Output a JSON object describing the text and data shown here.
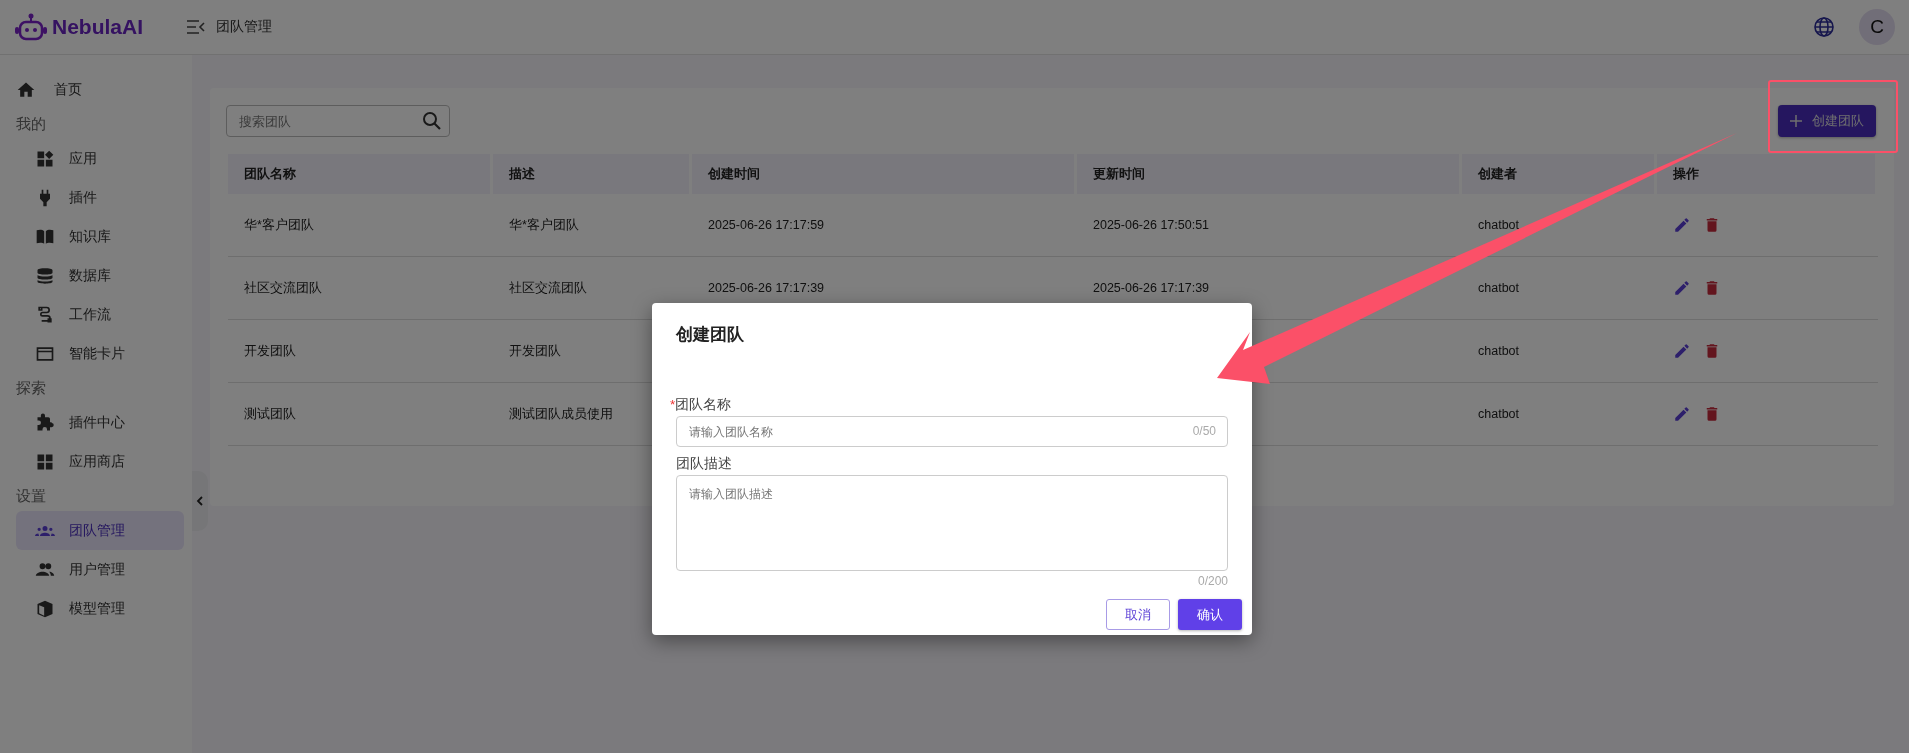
{
  "header": {
    "logo": "NebulaAI",
    "title": "团队管理",
    "avatar": "C"
  },
  "sidebar": [
    {
      "kind": "item",
      "label": "首页",
      "selected": false
    },
    {
      "kind": "section",
      "label": "我的"
    },
    {
      "kind": "item",
      "label": "应用",
      "selected": false
    },
    {
      "kind": "item",
      "label": "插件",
      "selected": false
    },
    {
      "kind": "item",
      "label": "知识库",
      "selected": false
    },
    {
      "kind": "item",
      "label": "数据库",
      "selected": false
    },
    {
      "kind": "item",
      "label": "工作流",
      "selected": false
    },
    {
      "kind": "item",
      "label": "智能卡片",
      "selected": false
    },
    {
      "kind": "section",
      "label": "探索"
    },
    {
      "kind": "item",
      "label": "插件中心",
      "selected": false
    },
    {
      "kind": "item",
      "label": "应用商店",
      "selected": false
    },
    {
      "kind": "section",
      "label": "设置"
    },
    {
      "kind": "item",
      "label": "团队管理",
      "selected": true
    },
    {
      "kind": "item",
      "label": "用户管理",
      "selected": false
    },
    {
      "kind": "item",
      "label": "模型管理",
      "selected": false
    }
  ],
  "search": {
    "placeholder": "搜索团队"
  },
  "create_button": "创建团队",
  "table": {
    "columns": [
      "团队名称",
      "描述",
      "创建时间",
      "更新时间",
      "创建者",
      "操作"
    ],
    "rows": [
      {
        "name": "华*客户团队",
        "description": "华*客户团队",
        "created": "2025-06-26 17:17:59",
        "updated": "2025-06-26 17:50:51",
        "creator": "chatbot"
      },
      {
        "name": "社区交流团队",
        "description": "社区交流团队",
        "created": "2025-06-26 17:17:39",
        "updated": "2025-06-26 17:17:39",
        "creator": "chatbot"
      },
      {
        "name": "开发团队",
        "description": "开发团队",
        "creator": "chatbot"
      },
      {
        "name": "测试团队",
        "description": "测试团队成员使用",
        "creator": "chatbot"
      }
    ]
  },
  "dialog": {
    "title": "创建团队",
    "name_field": {
      "required_mark": "*",
      "label": "团队名称",
      "placeholder": "请输入团队名称",
      "counter": "0/50"
    },
    "description_field": {
      "label": "团队描述",
      "placeholder": "请输入团队描述",
      "counter": "0/200"
    },
    "buttons": [
      {
        "kind": "secondary",
        "label": "取消"
      },
      {
        "kind": "primary",
        "label": "确认"
      }
    ]
  }
}
